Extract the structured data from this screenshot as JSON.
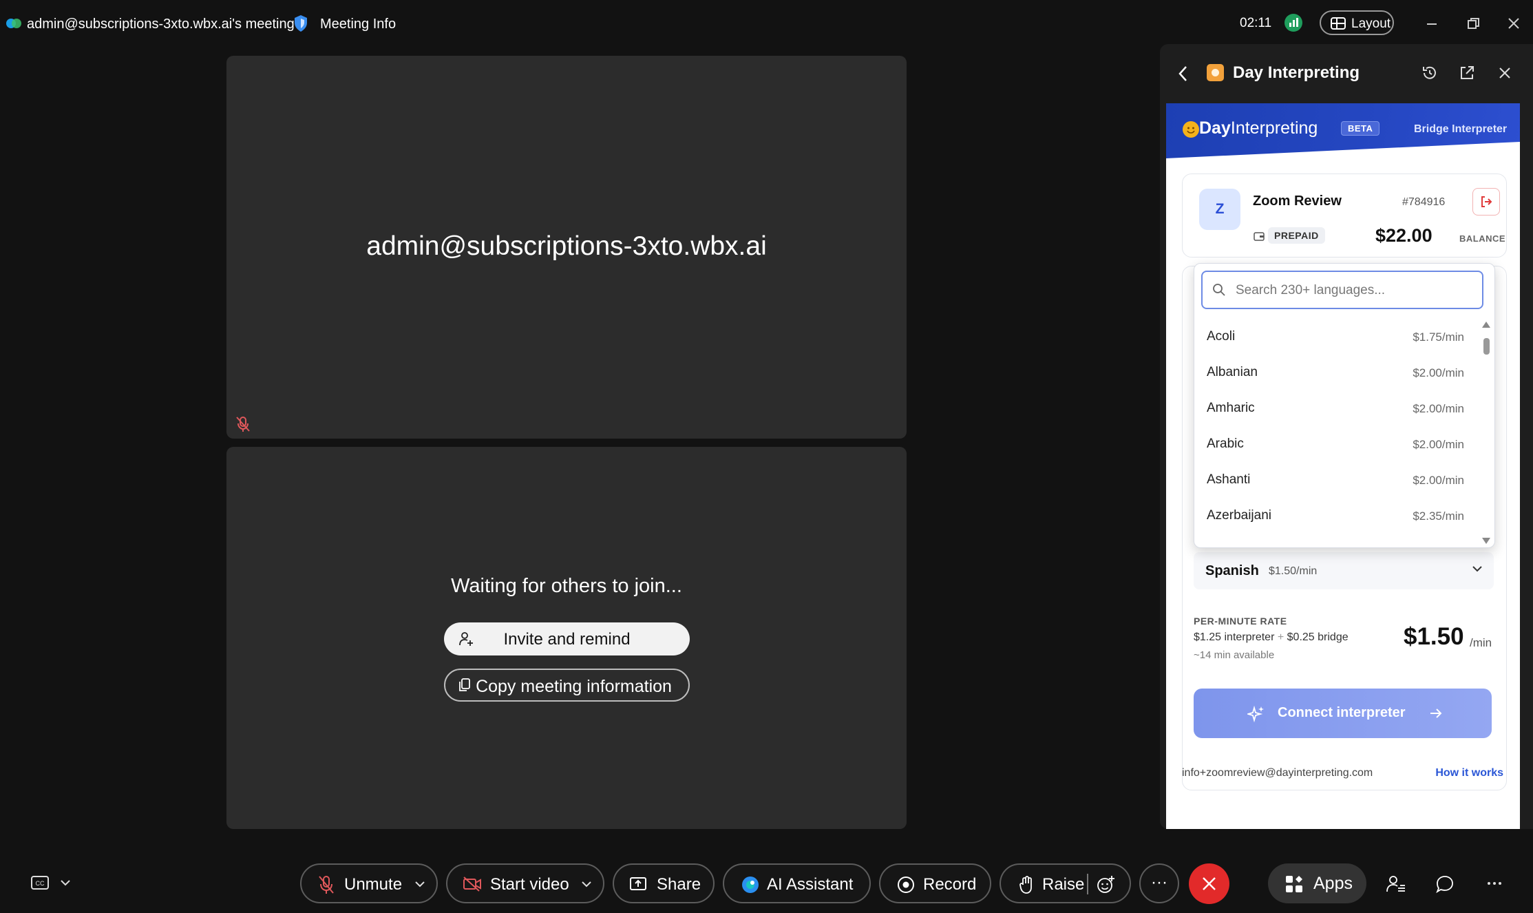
{
  "titlebar": {
    "title": "admin@subscriptions-3xto.wbx.ai's meeting",
    "meeting_info": "Meeting Info",
    "time": "02:11",
    "layout_label": "Layout",
    "icons": [
      "webex-logo-icon",
      "shield-icon",
      "signal-icon",
      "layout-grid-icon",
      "minimize-icon",
      "restore-icon",
      "close-icon"
    ]
  },
  "tiles": {
    "participant_name": "admin@subscriptions-3xto.wbx.ai",
    "waiting_text": "Waiting for others to join...",
    "invite_label": "Invite and remind",
    "copy_label": "Copy meeting information"
  },
  "panel": {
    "title": "Day Interpreting",
    "app": {
      "brand_bold": "Day",
      "brand_rest": "Interpreting",
      "beta": "BETA",
      "mode": "Bridge Interpreter",
      "account": {
        "avatar": "Z",
        "name": "Zoom Review",
        "id": "#784916",
        "plan": "PREPAID",
        "balance": "$22.00",
        "balance_label": "BALANCE"
      },
      "search": {
        "placeholder": "Search 230+ languages...",
        "value": ""
      },
      "languages": [
        {
          "name": "Acoli",
          "rate": "$1.75/min"
        },
        {
          "name": "Albanian",
          "rate": "$2.00/min"
        },
        {
          "name": "Amharic",
          "rate": "$2.00/min"
        },
        {
          "name": "Arabic",
          "rate": "$2.00/min"
        },
        {
          "name": "Ashanti",
          "rate": "$2.00/min"
        },
        {
          "name": "Azerbaijani",
          "rate": "$2.35/min"
        }
      ],
      "selected": {
        "name": "Spanish",
        "rate": "$1.50/min"
      },
      "rate": {
        "label": "PER-MINUTE RATE",
        "interpreter": "$1.25 interpreter",
        "plus": "+",
        "bridge": "$0.25 bridge",
        "available": "~14 min available",
        "value": "$1.50",
        "unit": "/min"
      },
      "connect_label": "Connect interpreter",
      "footer_email": "info+zoomreview@dayinterpreting.com",
      "footer_link": "How it works"
    }
  },
  "toolbar": {
    "unmute": "Unmute",
    "start_video": "Start video",
    "share": "Share",
    "ai_assistant": "AI Assistant",
    "record": "Record",
    "raise": "Raise",
    "more": "···",
    "apps": "Apps",
    "colors": {
      "end_call": "#e22a2a",
      "muted_icon": "#e0585b"
    }
  }
}
